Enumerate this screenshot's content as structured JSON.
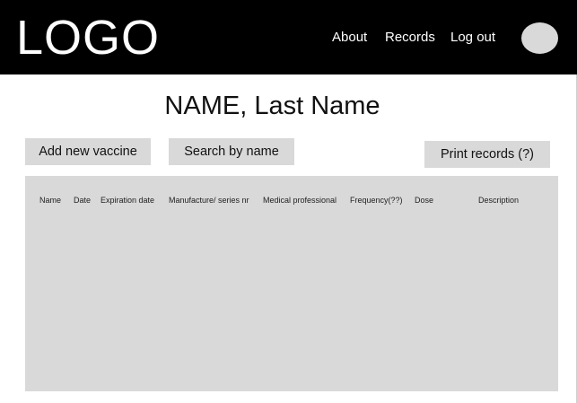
{
  "header": {
    "logo": "LOGO",
    "nav": {
      "about": "About",
      "records": "Records",
      "logout": "Log out"
    }
  },
  "main": {
    "title": "NAME, Last Name",
    "buttons": {
      "add": "Add new vaccine",
      "search": "Search by name",
      "print": "Print records (?)"
    },
    "table": {
      "columns": [
        "Name",
        "Date",
        "Expiration date",
        "Manufacture/ series nr",
        "Medical professional",
        "Frequency(??)",
        "Dose",
        "Description"
      ],
      "rows": []
    }
  },
  "colors": {
    "header_bg": "#000000",
    "placeholder_gray": "#d9d9d9",
    "text": "#111111"
  }
}
